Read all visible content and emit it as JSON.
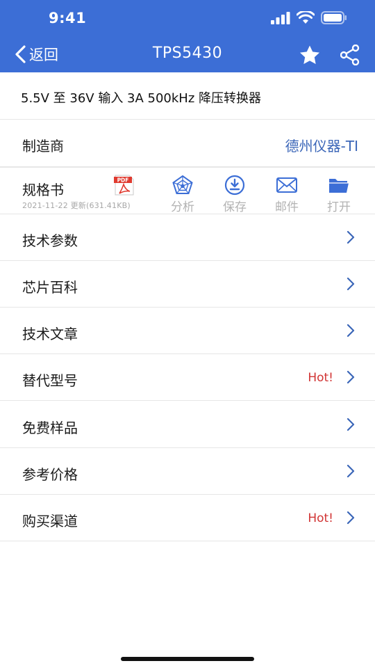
{
  "status_bar": {
    "time": "9:41"
  },
  "nav": {
    "back_label": "返回",
    "title": "TPS5430"
  },
  "description": "5.5V 至 36V 输入 3A 500kHz 降压转换器",
  "manufacturer": {
    "label": "制造商",
    "value": "德州仪器-TI"
  },
  "datasheet": {
    "label": "规格书",
    "meta": "2021-11-22 更新(631.41KB)",
    "pdf_text": "PDF",
    "tools": [
      {
        "label": "分析",
        "icon": "spiderweb-icon"
      },
      {
        "label": "保存",
        "icon": "download-icon"
      },
      {
        "label": "邮件",
        "icon": "mail-icon"
      },
      {
        "label": "打开",
        "icon": "folder-icon"
      }
    ]
  },
  "menu": [
    {
      "label": "技术参数",
      "badge": ""
    },
    {
      "label": "芯片百科",
      "badge": ""
    },
    {
      "label": "技术文章",
      "badge": ""
    },
    {
      "label": "替代型号",
      "badge": "Hot!"
    },
    {
      "label": "免费样品",
      "badge": ""
    },
    {
      "label": "参考价格",
      "badge": ""
    },
    {
      "label": "购买渠道",
      "badge": "Hot!"
    }
  ],
  "colors": {
    "header": "#3c6ed6",
    "link": "#3b66b8",
    "hot": "#d13434",
    "icon_blue": "#3c6ed6",
    "pdf_red": "#e03a2f"
  }
}
